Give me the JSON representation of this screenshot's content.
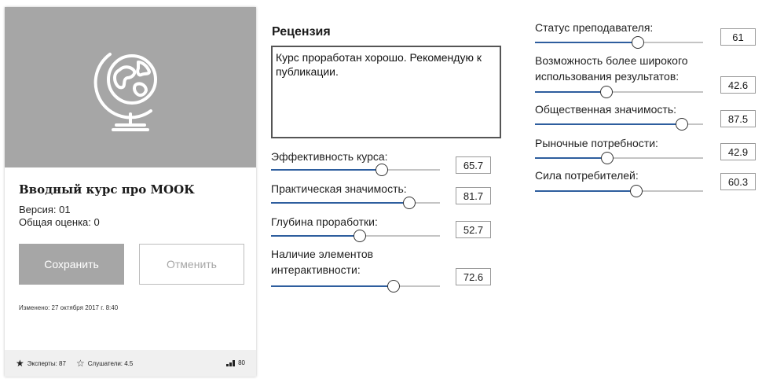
{
  "course": {
    "title": "Вводный курс про МООК",
    "version": "Версия: 01",
    "rating": "Общая оценка: 0",
    "modified": "Изменено: 27 октября 2017 г. 8:40",
    "image_icon": "globe-icon"
  },
  "buttons": {
    "save": "Сохранить",
    "cancel": "Отменить"
  },
  "footer": {
    "experts": "Эксперты: 87",
    "listeners": "Слушатели: 4.5",
    "views": "80"
  },
  "review": {
    "title": "Рецензия",
    "text": "Курс проработан хорошо. Рекомендую к публикации."
  },
  "sliders_left": [
    {
      "label": "Эффективность курса:",
      "value": "65.7",
      "fraction": 0.657
    },
    {
      "label": "Практическая значимость:",
      "value": "81.7",
      "fraction": 0.817
    },
    {
      "label": "Глубина проработки:",
      "value": "52.7",
      "fraction": 0.527
    },
    {
      "label_line1": "Наличие элементов",
      "label_line2": "интерактивности:",
      "value": "72.6",
      "fraction": 0.726
    }
  ],
  "sliders_right": [
    {
      "label": "Статус преподавателя:",
      "value": "61",
      "fraction": 0.61
    },
    {
      "label_line1": "Возможность более широкого",
      "label_line2": "использования результатов:",
      "value": "42.6",
      "fraction": 0.426
    },
    {
      "label": "Общественная значимость:",
      "value": "87.5",
      "fraction": 0.875
    },
    {
      "label": "Рыночные потребности:",
      "value": "42.9",
      "fraction": 0.429
    },
    {
      "label": "Сила потребителей:",
      "value": "60.3",
      "fraction": 0.603
    }
  ],
  "colors": {
    "accent": "#2e5e9e",
    "image_bg": "#a6a6a6",
    "footer_bg": "#f0f0f0"
  }
}
